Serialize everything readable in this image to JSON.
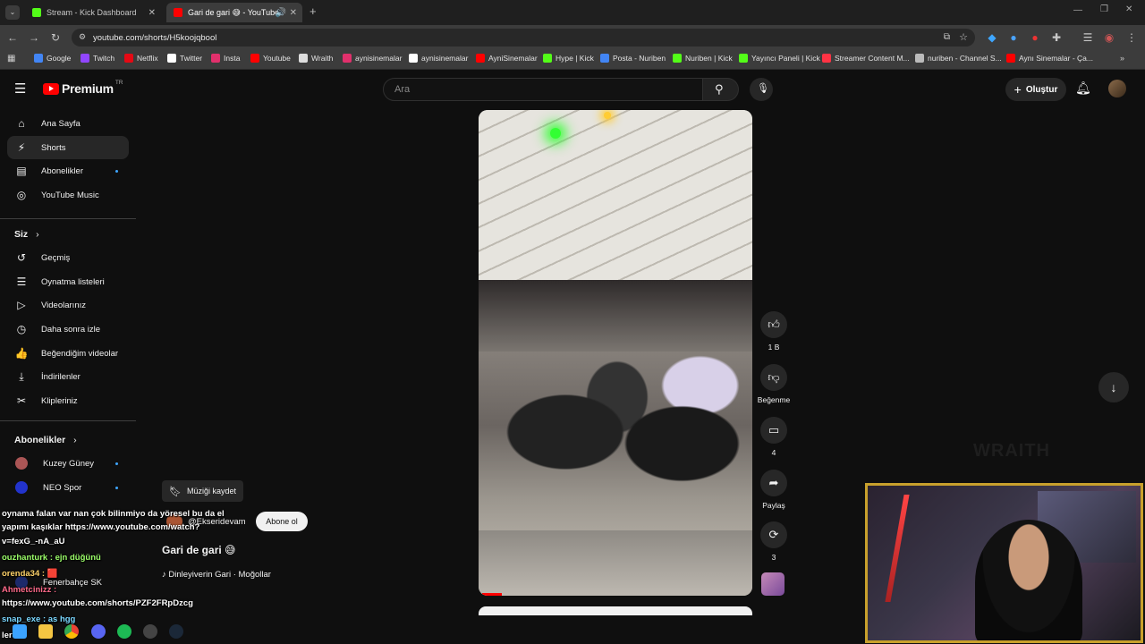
{
  "browser": {
    "tabs": [
      {
        "title": "Stream - Kick Dashboard",
        "favicon_color": "#53fc18",
        "active": false
      },
      {
        "title": "Gari de gari 😅 - YouTube",
        "favicon_color": "#ff0000",
        "active": true
      }
    ],
    "new_tab": "+",
    "url": "youtube.com/shorts/H5koojqbool",
    "bookmarks": [
      {
        "label": "Google",
        "color": "#4285f4"
      },
      {
        "label": "Twitch",
        "color": "#9146ff"
      },
      {
        "label": "Netflix",
        "color": "#e50914"
      },
      {
        "label": "Twitter",
        "color": "#ffffff"
      },
      {
        "label": "Insta",
        "color": "#e1306c"
      },
      {
        "label": "Youtube",
        "color": "#ff0000"
      },
      {
        "label": "Wraith",
        "color": "#dddddd"
      },
      {
        "label": "aynisinemalar",
        "color": "#e1306c"
      },
      {
        "label": "aynisinemalar",
        "color": "#ffffff"
      },
      {
        "label": "AyniSinemalar",
        "color": "#ff0000"
      },
      {
        "label": "Hype | Kick",
        "color": "#53fc18"
      },
      {
        "label": "Posta - Nuriben",
        "color": "#4285f4"
      },
      {
        "label": "Nuriben | Kick",
        "color": "#53fc18"
      },
      {
        "label": "Yayıncı Paneli | Kick",
        "color": "#53fc18"
      },
      {
        "label": "Streamer Content M...",
        "color": "#ff3344"
      },
      {
        "label": "nuriben - Channel S...",
        "color": "#bbbbbb"
      },
      {
        "label": "Aynı Sinemalar - Ça...",
        "color": "#ff0000"
      }
    ]
  },
  "youtube": {
    "logo_text": "Premium",
    "logo_region": "TR",
    "search_placeholder": "Ara",
    "create_label": "Oluştur",
    "sidebar": {
      "main": [
        {
          "label": "Ana Sayfa",
          "icon": "home-icon",
          "glyph": "⌂"
        },
        {
          "label": "Shorts",
          "icon": "shorts-icon",
          "glyph": "⚡"
        },
        {
          "label": "Abonelikler",
          "icon": "subscriptions-icon",
          "glyph": "▤"
        },
        {
          "label": "YouTube Music",
          "icon": "music-icon",
          "glyph": "◎"
        }
      ],
      "you_heading": "Siz",
      "you": [
        {
          "label": "Geçmiş",
          "icon": "history-icon",
          "glyph": "↺"
        },
        {
          "label": "Oynatma listeleri",
          "icon": "playlists-icon",
          "glyph": "☰"
        },
        {
          "label": "Videolarınız",
          "icon": "your-videos-icon",
          "glyph": "▷"
        },
        {
          "label": "Daha sonra izle",
          "icon": "watch-later-icon",
          "glyph": "◷"
        },
        {
          "label": "Beğendiğim videolar",
          "icon": "liked-icon",
          "glyph": "👍"
        },
        {
          "label": "İndirilenler",
          "icon": "downloads-icon",
          "glyph": "⤓"
        },
        {
          "label": "Klipleriniz",
          "icon": "clips-icon",
          "glyph": "✂"
        }
      ],
      "subs_heading": "Abonelikler",
      "subs": [
        {
          "label": "Kuzey Güney",
          "color": "#a55"
        },
        {
          "label": "NEO Spor",
          "color": "#2233cc"
        },
        {
          "label": "Fenerbahçe SK",
          "color": "#1c2a6b"
        }
      ]
    },
    "short": {
      "save_music_label": "Müziği kaydet",
      "channel": "@Ekseridevam",
      "subscribe_label": "Abone ol",
      "title": "Gari de gari 😅",
      "music": "♪ Dinleyiverin Gari · Moğollar"
    },
    "actions": {
      "like_count": "1 B",
      "dislike_label": "Beğenme",
      "comments_count": "4",
      "share_label": "Paylaş",
      "remix_count": "3"
    }
  },
  "stream_overlay": {
    "chat": [
      "oynama falan var nan çok bilinmiyo da yöresel bu da el",
      "yapımı kaşıklar https://www.youtube.com/watch?",
      "v=fexG_-nA_aU",
      "ouzhanturk : ejn düğünü",
      "orenda34 : 🟥",
      "Ahmetcinizz :",
      "https://www.youtube.com/shorts/PZF2FRpDzcg",
      "snap_exe : as hgg",
      "lerdi"
    ],
    "watermark": "WRAITH"
  }
}
